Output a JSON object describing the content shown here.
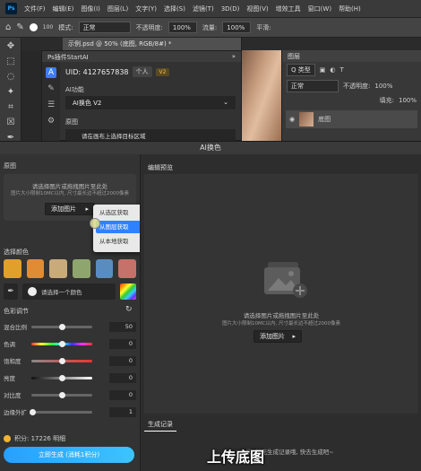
{
  "menubar": {
    "logo": "Ps",
    "items": [
      "文件(F)",
      "编辑(E)",
      "图像(I)",
      "图层(L)",
      "文字(Y)",
      "选择(S)",
      "滤镜(T)",
      "3D(D)",
      "视图(V)",
      "增效工具",
      "窗口(W)",
      "帮助(H)"
    ]
  },
  "options": {
    "size": "100",
    "mode_label": "模式:",
    "mode_value": "正常",
    "opacity_label": "不透明度:",
    "opacity_value": "100%",
    "flow_label": "流量:",
    "flow_value": "100%",
    "smooth_label": "平滑:"
  },
  "document": {
    "tab": "示例.psd @ 50% (底图, RGB/8#) *"
  },
  "plugin_small": {
    "title": "Ps插件StartAI",
    "uid": "UID: 4127657838",
    "account": "个人",
    "vip": "V2",
    "ai_func_label": "AI功能",
    "ai_func_value": "AI换色 V2",
    "source_label": "原图",
    "source_hint": "请在画布上选择目标区域"
  },
  "layers": {
    "title": "图层",
    "filter": "Q 类型",
    "blend": "正常",
    "opacity_label": "不透明度:",
    "opacity_value": "100%",
    "fill_label": "填充:",
    "fill_value": "100%",
    "layer_name": "底图"
  },
  "ai_window": {
    "title": "AI换色",
    "original_label": "原图",
    "drop_hint": "请选择图片或拖拽图片至此处",
    "drop_sub": "图片大小限制10MC以内, 尺寸最长边不超过2000像素",
    "upload_label": "添加图片",
    "dropdown": [
      "从选区获取",
      "从图层获取",
      "从本地获取"
    ],
    "select_color_label": "选择颜色",
    "swatch_colors": [
      "#e0a02a",
      "#e08c34",
      "#c9aa7a",
      "#8fa56e",
      "#5a8dbf",
      "#c4726a"
    ],
    "pick_color_label": "请选择一个颜色",
    "adjust_label": "色彩调节",
    "sliders": [
      {
        "label": "混合比例",
        "value": "50",
        "pos": 0.5
      },
      {
        "label": "色调",
        "value": "0",
        "pos": 0.5
      },
      {
        "label": "饱和度",
        "value": "0",
        "pos": 0.5
      },
      {
        "label": "亮度",
        "value": "0",
        "pos": 0.5
      },
      {
        "label": "对比度",
        "value": "0",
        "pos": 0.5
      },
      {
        "label": "边缘外扩",
        "value": "1",
        "pos": 0.02
      }
    ],
    "points_label": "积分: 17226 明细",
    "generate_label": "立即生成 (消耗1积分)",
    "edit_tab": "编辑预览",
    "preview_hint": "请选择图片或拖拽图片至此处",
    "preview_sub": "图片大小限制10MC以内, 尺寸最长边不超过2000像素",
    "preview_upload": "添加图片",
    "history_tab": "生成记录",
    "history_empty": "暂无生成记录哦, 快去生成吧~"
  },
  "subtitle": "上传底图"
}
